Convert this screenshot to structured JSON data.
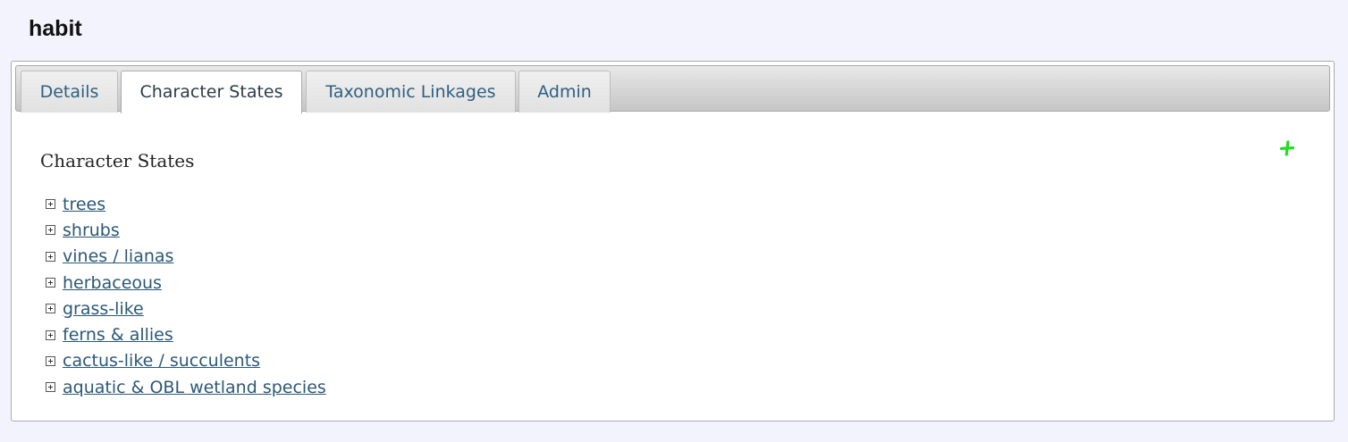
{
  "page": {
    "title": "habit"
  },
  "tabs": [
    {
      "label": "Details",
      "active": false
    },
    {
      "label": "Character States",
      "active": true
    },
    {
      "label": "Taxonomic Linkages",
      "active": false
    },
    {
      "label": "Admin",
      "active": false
    }
  ],
  "content": {
    "section_title": "Character States",
    "add_icon": "plus-icon",
    "add_color": "#22dd22",
    "states": [
      {
        "label": "trees",
        "icon": "expand-plus-icon"
      },
      {
        "label": "shrubs",
        "icon": "expand-plus-icon"
      },
      {
        "label": "vines / lianas",
        "icon": "expand-plus-icon"
      },
      {
        "label": "herbaceous",
        "icon": "expand-plus-icon"
      },
      {
        "label": "grass-like",
        "icon": "expand-plus-icon"
      },
      {
        "label": "ferns & allies",
        "icon": "expand-plus-icon"
      },
      {
        "label": "cactus-like / succulents",
        "icon": "expand-plus-icon"
      },
      {
        "label": "aquatic & OBL wetland species",
        "icon": "expand-plus-icon"
      }
    ]
  },
  "colors": {
    "page_background": "#f3f3fe",
    "link": "#2b5876",
    "tab_text": "#2e5f82"
  }
}
